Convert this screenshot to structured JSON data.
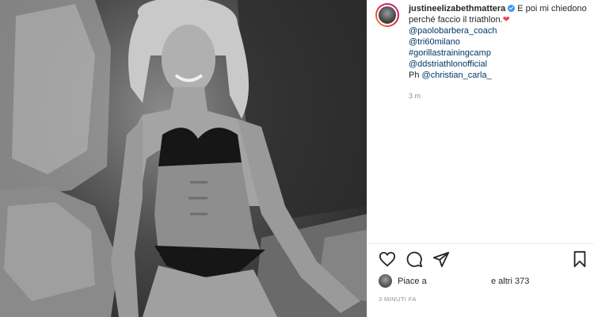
{
  "post": {
    "username": "justineelizabethmattera",
    "caption_text": "E poi mi chiedono perché faccio il triathlon.",
    "caption_emoji": "❤",
    "tags": [
      "@paolobarbera_coach",
      "@tri60milano",
      "#gorillastrainingcamp",
      "@ddstriathlonofficial"
    ],
    "photo_credit_prefix": "Ph",
    "photo_credit_handle": "@christian_carla_",
    "time_ago": "3 m",
    "likes_prefix": "Piace a",
    "likes_suffix": "e altri 373",
    "date": "3 MINUTI FA"
  },
  "icons": {
    "like": "heart-outline-icon",
    "comment": "comment-bubble-icon",
    "share": "paper-plane-icon",
    "save": "bookmark-icon",
    "verified": "verified-badge-icon"
  },
  "colors": {
    "link": "#00376b",
    "verified": "#3897f0",
    "heart": "#ed4956",
    "muted": "#8e8e8e"
  }
}
